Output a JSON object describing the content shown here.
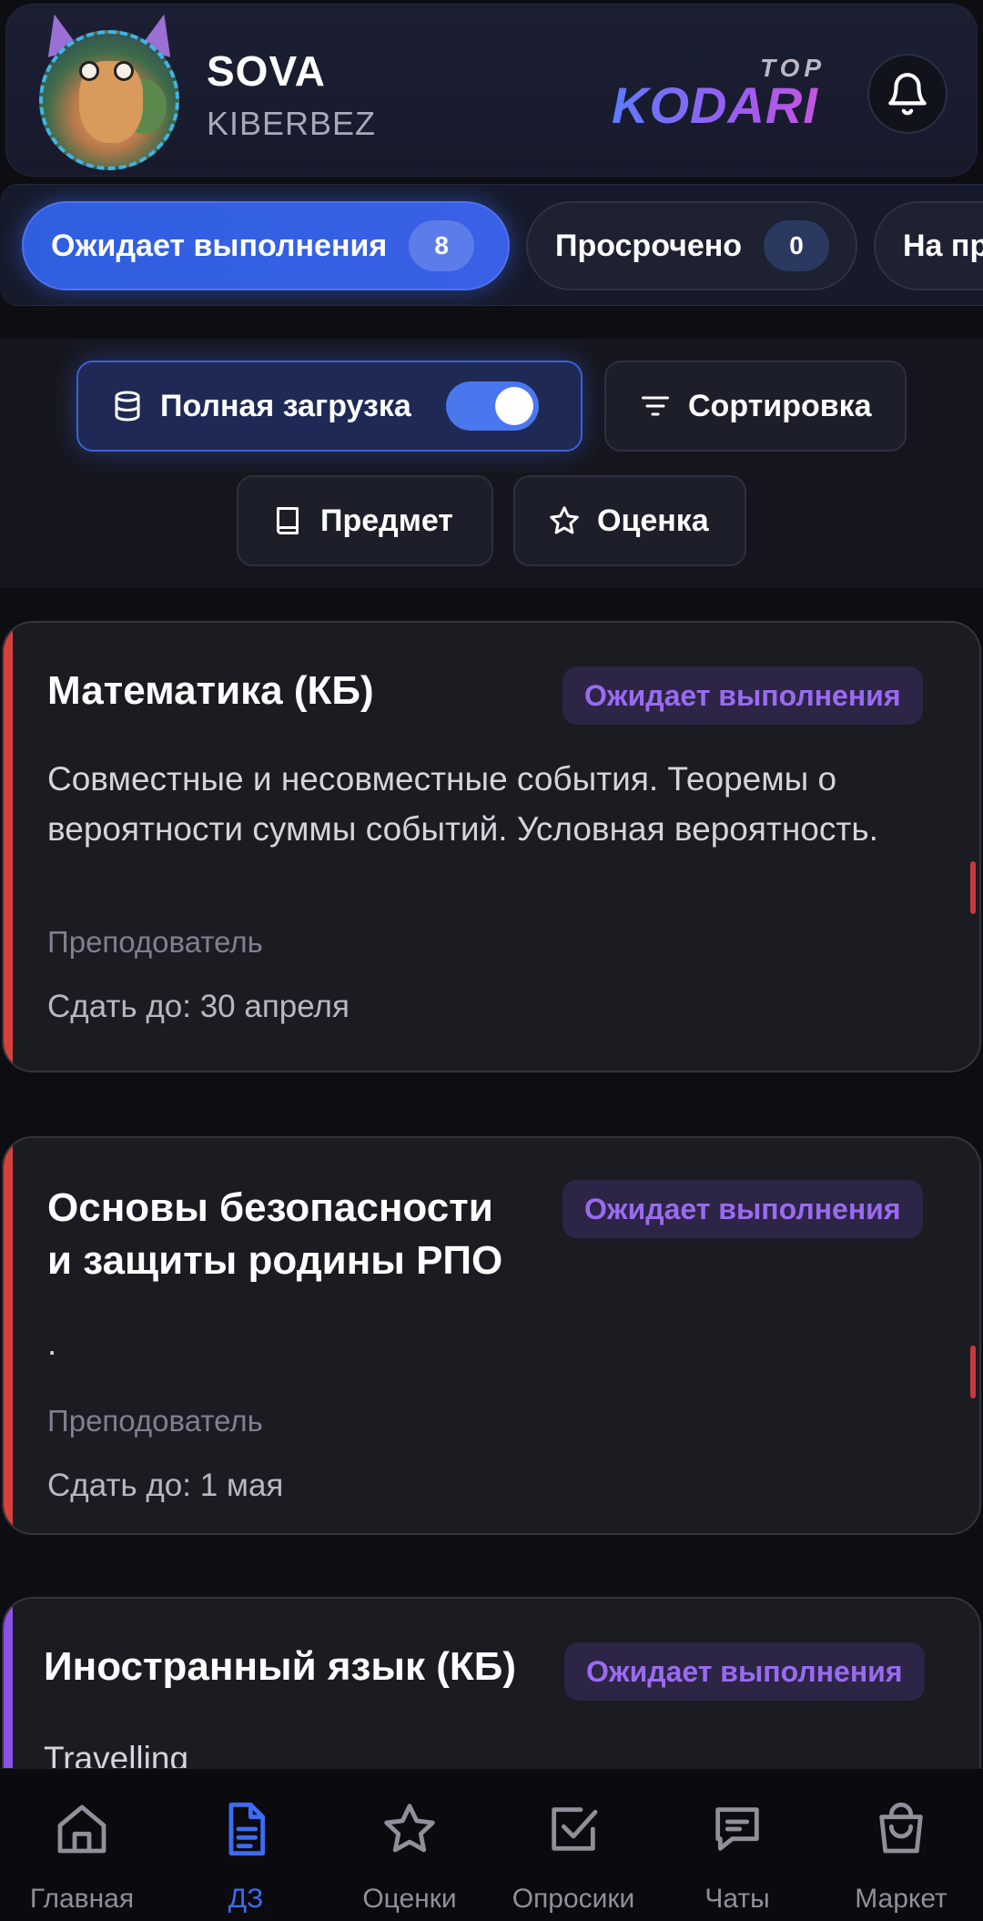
{
  "header": {
    "user_name": "SOVA",
    "user_group": "KIBERBEZ",
    "logo_top": "TOP",
    "logo_main": "KODARI"
  },
  "tabs": [
    {
      "label": "Ожидает выполнения",
      "count": "8",
      "active": true
    },
    {
      "label": "Просрочено",
      "count": "0",
      "active": false
    },
    {
      "label": "На пр",
      "count": "",
      "active": false
    }
  ],
  "filters": {
    "full_load": "Полная загрузка",
    "full_load_enabled": true,
    "sort": "Сортировка",
    "subject": "Предмет",
    "grade": "Оценка"
  },
  "cards": [
    {
      "title": "Математика (КБ)",
      "status": "Ожидает выполнения",
      "description": "Совместные и несовместные события. Теоремы о вероятности суммы событий. Условная вероятность.",
      "teacher": "Преподователь",
      "due": "Сдать до: 30 апреля"
    },
    {
      "title_line1": "Основы безопасности",
      "title_line2": "и защиты родины РПО",
      "status": "Ожидает выполнения",
      "description": ".",
      "teacher": "Преподователь",
      "due": "Сдать до: 1 мая"
    },
    {
      "title": "Иностранный язык (КБ)",
      "status": "Ожидает выполнения",
      "description": "Travelling"
    }
  ],
  "nav": [
    {
      "label": "Главная",
      "icon": "home-icon",
      "active": false
    },
    {
      "label": "ДЗ",
      "icon": "document-icon",
      "active": true
    },
    {
      "label": "Оценки",
      "icon": "star-icon",
      "active": false
    },
    {
      "label": "Опросики",
      "icon": "checkbox-icon",
      "active": false
    },
    {
      "label": "Чаты",
      "icon": "chat-icon",
      "active": false
    },
    {
      "label": "Маркет",
      "icon": "bag-icon",
      "active": false
    }
  ],
  "colors": {
    "accent": "#3a60e6",
    "status_badge_text": "#9a6bf0",
    "card_stripe_red": "#d8403b",
    "card_stripe_purple": "#8a52e6"
  }
}
